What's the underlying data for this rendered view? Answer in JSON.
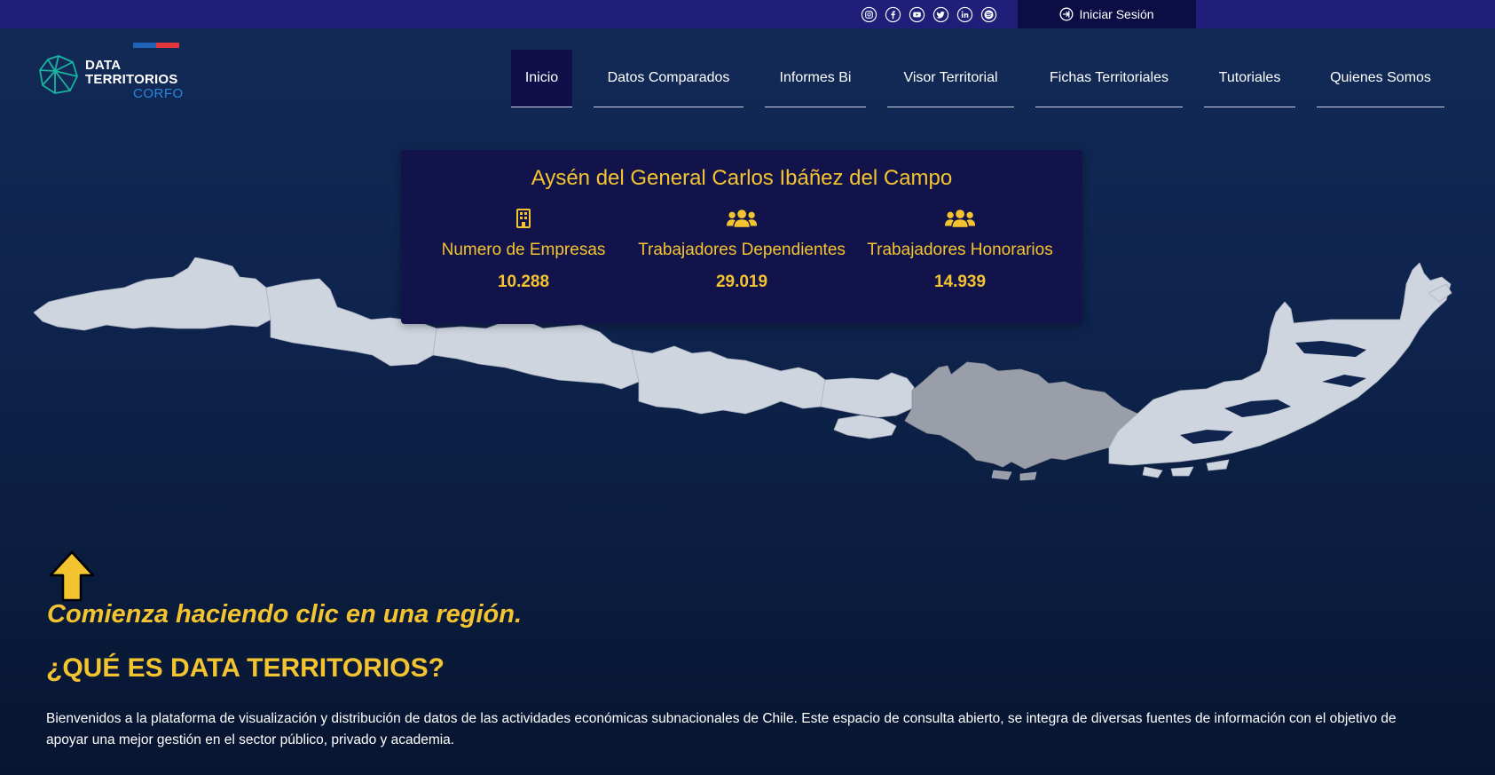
{
  "topbar": {
    "social_icons": [
      "instagram-icon",
      "facebook-icon",
      "youtube-icon",
      "twitter-icon",
      "linkedin-icon",
      "spotify-icon"
    ],
    "login_label": "Iniciar Sesión"
  },
  "logo": {
    "line1": "DATA",
    "line2": "TERRITORIOS",
    "line3": "CORFO"
  },
  "nav": {
    "items": [
      {
        "label": "Inicio",
        "active": true
      },
      {
        "label": "Datos Comparados",
        "active": false
      },
      {
        "label": "Informes Bi",
        "active": false
      },
      {
        "label": "Visor Territorial",
        "active": false
      },
      {
        "label": "Fichas Territoriales",
        "active": false
      },
      {
        "label": "Tutoriales",
        "active": false
      },
      {
        "label": "Quienes Somos",
        "active": false
      }
    ]
  },
  "region_card": {
    "title": "Aysén del General Carlos Ibáñez del Campo",
    "stats": [
      {
        "icon": "building-icon",
        "label": "Numero de Empresas",
        "value": "10.288"
      },
      {
        "icon": "users-icon",
        "label": "Trabajadores Dependientes",
        "value": "29.019"
      },
      {
        "icon": "users-icon",
        "label": "Trabajadores Honorarios",
        "value": "14.939"
      }
    ]
  },
  "map": {
    "selected_region": "Aysén del General Carlos Ibáñez del Campo",
    "region_color": "#cfd5df",
    "selected_color": "#9a9ea8"
  },
  "content": {
    "cta": "Comienza haciendo clic en una región.",
    "heading": "¿QUÉ ES DATA TERRITORIOS?",
    "paragraph": "Bienvenidos a la plataforma de visualización y distribución de datos de las actividades económicas subnacionales de Chile. Este espacio de consulta abierto, se integra de diversas fuentes de información con el objetivo de apoyar una mejor gestión en el sector público, privado y academia."
  },
  "colors": {
    "topbar": "#1f1f7a",
    "accent_yellow": "#f4c430",
    "card_bg": "#12134a",
    "corfo_blue": "#2a86d9"
  }
}
